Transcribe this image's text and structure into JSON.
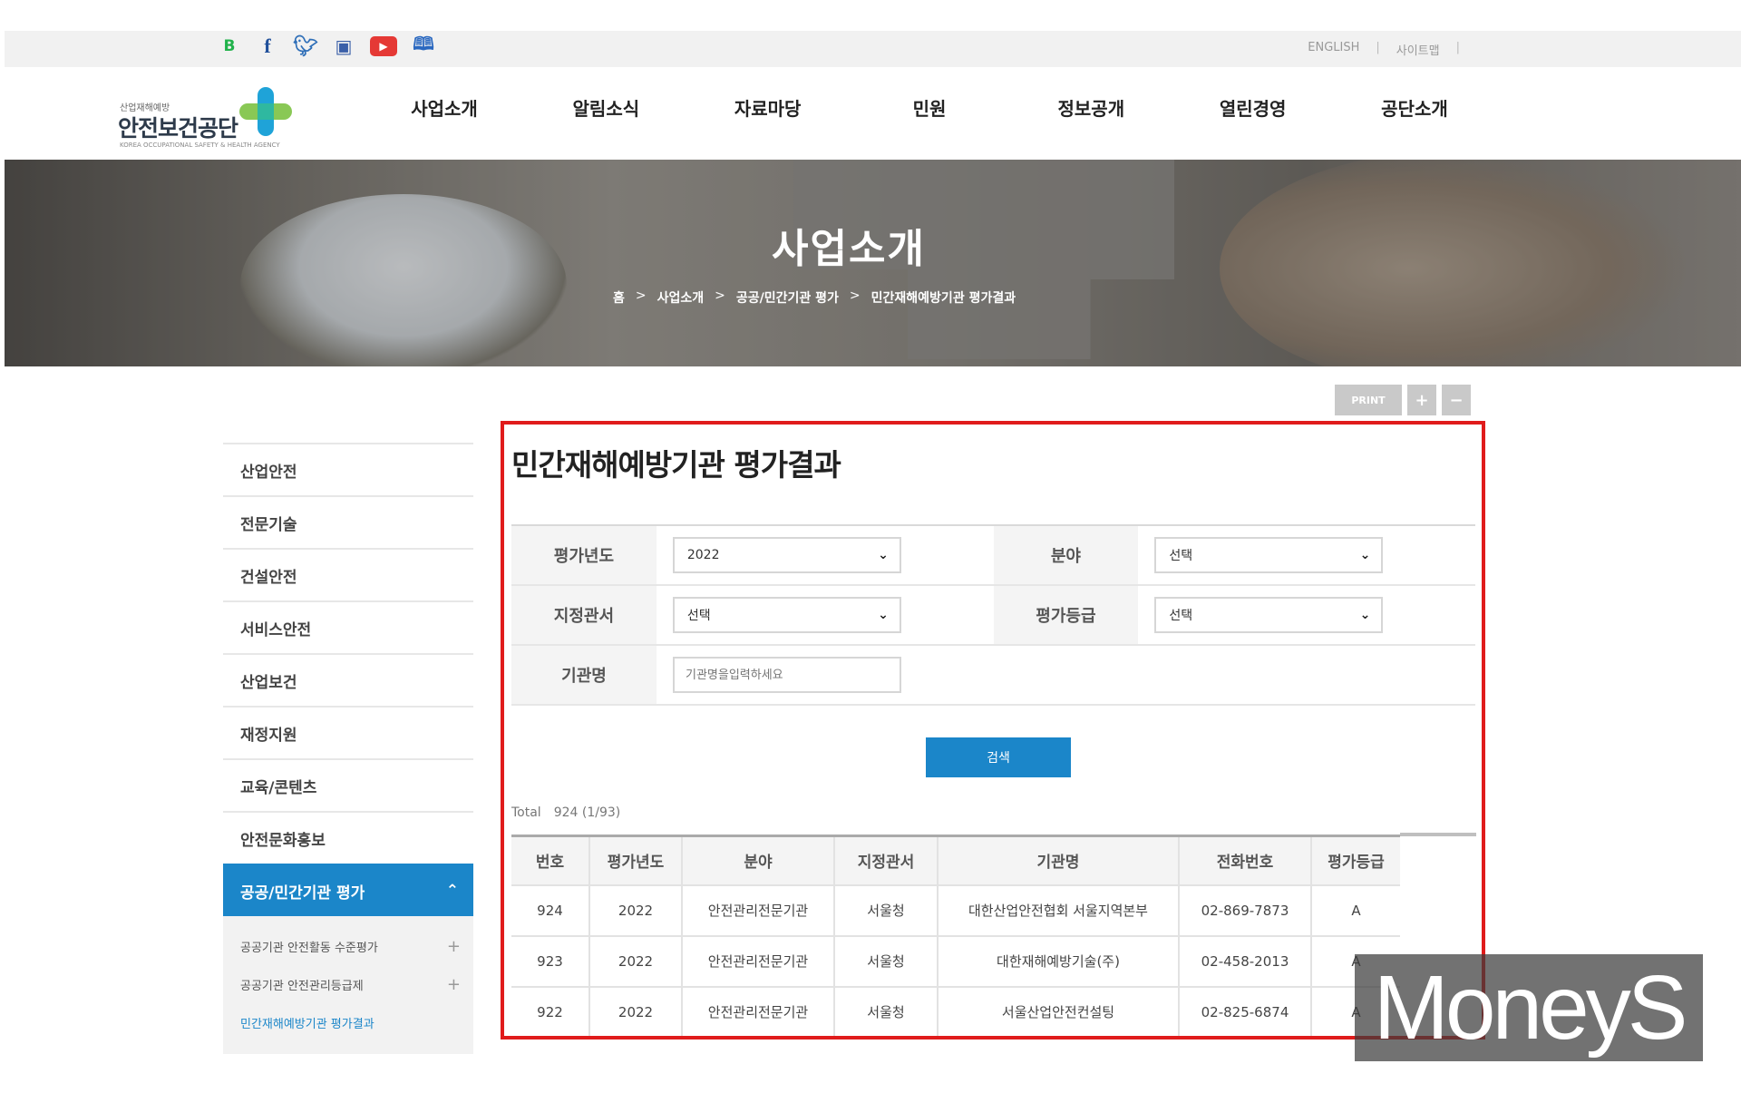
{
  "social": [
    "B",
    "f",
    "twitter-icon",
    "instagram-icon",
    "youtube-icon",
    "book-icon"
  ],
  "util_links": [
    "ENGLISH",
    "사이트맵"
  ],
  "logo": {
    "small": "산업재해예방",
    "name": "안전보건공단",
    "tiny": "KOREA OCCUPATIONAL SAFETY & HEALTH AGENCY"
  },
  "gnb": [
    "사업소개",
    "알림소식",
    "자료마당",
    "민원",
    "정보공개",
    "열린경영",
    "공단소개"
  ],
  "hero": {
    "title": "사업소개"
  },
  "breadcrumb": [
    "홈",
    "사업소개",
    "공공/민간기관 평가",
    "민간재해예방기관 평가결과"
  ],
  "tools": {
    "print": "PRINT",
    "plus": "+",
    "minus": "−"
  },
  "lnb": {
    "items": [
      "산업안전",
      "전문기술",
      "건설안전",
      "서비스안전",
      "산업보건",
      "재정지원",
      "교육/콘텐츠",
      "안전문화홍보"
    ],
    "active": "공공/민간기관 평가",
    "sub": [
      "공공기관 안전활동 수준평가",
      "공공기관 안전관리등급제",
      "민간재해예방기관 평가결과"
    ]
  },
  "page_title": "민간재해예방기관 평가결과",
  "search": {
    "year_label": "평가년도",
    "year_value": "2022",
    "field_label": "분야",
    "field_value": "선택",
    "office_label": "지정관서",
    "office_value": "선택",
    "grade_label": "평가등급",
    "grade_value": "선택",
    "name_label": "기관명",
    "name_placeholder": "기관명을입력하세요",
    "button": "검색"
  },
  "total": {
    "label": "Total",
    "value": "924 (1/93)"
  },
  "table": {
    "headers": [
      "번호",
      "평가년도",
      "분야",
      "지정관서",
      "기관명",
      "전화번호",
      "평가등급"
    ],
    "rows": [
      [
        "924",
        "2022",
        "안전관리전문기관",
        "서울청",
        "대한산업안전협회 서울지역본부",
        "02-869-7873",
        "A"
      ],
      [
        "923",
        "2022",
        "안전관리전문기관",
        "서울청",
        "대한재해예방기술(주)",
        "02-458-2013",
        "A"
      ],
      [
        "922",
        "2022",
        "안전관리전문기관",
        "서울청",
        "서울산업안전컨설팅",
        "02-825-6874",
        "A"
      ]
    ]
  },
  "watermark": "MoneyS",
  "colors": {
    "accent": "#1b86c9",
    "highlight": "#e01b1b"
  }
}
